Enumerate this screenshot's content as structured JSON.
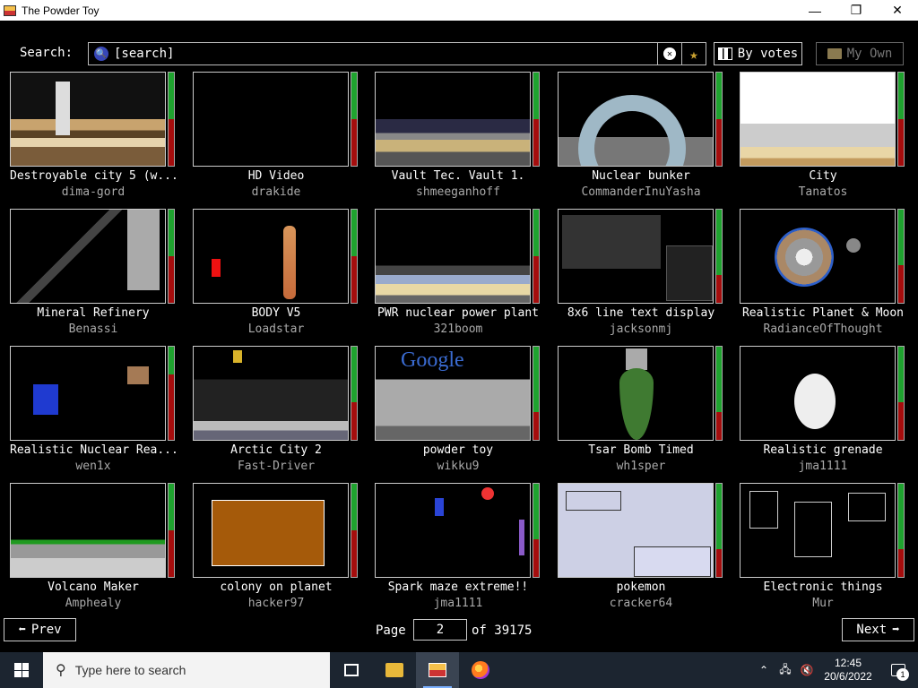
{
  "window": {
    "title": "The Powder Toy",
    "minimize": "—",
    "maximize": "❐",
    "close": "✕"
  },
  "search": {
    "label": "Search:",
    "placeholder": "[search]",
    "clear_glyph": "✕",
    "fav_glyph": "★"
  },
  "toolbar": {
    "sort_label": "By votes",
    "own_label": "My Own"
  },
  "saves": [
    {
      "title": "Destroyable city 5 (w...",
      "author": "dima-gord",
      "upvote_fraction": 0.5,
      "art": "city5"
    },
    {
      "title": "HD Video",
      "author": "drakide",
      "upvote_fraction": 0.5,
      "art": "black"
    },
    {
      "title": "Vault Tec. Vault 1.",
      "author": "shmeeganhoff",
      "upvote_fraction": 0.5,
      "art": "vault"
    },
    {
      "title": "Nuclear bunker",
      "author": "CommanderInuYasha",
      "upvote_fraction": 0.5,
      "art": "bunker"
    },
    {
      "title": "City",
      "author": "Tanatos",
      "upvote_fraction": 0.5,
      "art": "citysky"
    },
    {
      "title": "Mineral Refinery",
      "author": "Benassi",
      "upvote_fraction": 0.5,
      "art": "refinery"
    },
    {
      "title": "BODY V5",
      "author": "Loadstar",
      "upvote_fraction": 0.5,
      "art": "body"
    },
    {
      "title": "PWR nuclear power plant",
      "author": "321boom",
      "upvote_fraction": 0.5,
      "art": "pwr"
    },
    {
      "title": "8x6 line text display",
      "author": "jacksonmj",
      "upvote_fraction": 0.7,
      "art": "text"
    },
    {
      "title": "Realistic Planet & Moon",
      "author": "RadianceOfThought",
      "upvote_fraction": 0.6,
      "art": "planet"
    },
    {
      "title": "Realistic Nuclear Rea...",
      "author": "wen1x",
      "upvote_fraction": 0.3,
      "art": "nuclear"
    },
    {
      "title": "Arctic City 2",
      "author": "Fast-Driver",
      "upvote_fraction": 0.6,
      "art": "arctic"
    },
    {
      "title": "powder toy",
      "author": "wikku9",
      "upvote_fraction": 0.7,
      "art": "google"
    },
    {
      "title": "Tsar Bomb Timed",
      "author": "wh1sper",
      "upvote_fraction": 0.7,
      "art": "tsar"
    },
    {
      "title": "Realistic grenade",
      "author": "jma1111",
      "upvote_fraction": 0.6,
      "art": "grenade"
    },
    {
      "title": "Volcano Maker",
      "author": "Amphealy",
      "upvote_fraction": 0.5,
      "art": "volcano"
    },
    {
      "title": "colony on planet",
      "author": "hacker97",
      "upvote_fraction": 0.5,
      "art": "colony"
    },
    {
      "title": "Spark maze extreme!!",
      "author": "jma1111",
      "upvote_fraction": 0.6,
      "art": "spark"
    },
    {
      "title": "pokemon",
      "author": "cracker64",
      "upvote_fraction": 0.7,
      "art": "pokemon"
    },
    {
      "title": "Electronic things",
      "author": "Mur",
      "upvote_fraction": 0.7,
      "art": "elec"
    }
  ],
  "pagination": {
    "prev_label": "Prev",
    "next_label": "Next",
    "page_label": "Page",
    "current_page": "2",
    "of_label": "of 39175",
    "prev_arrow": "⬅",
    "next_arrow": "➡"
  },
  "taskbar": {
    "search_placeholder": "Type here to search",
    "search_glyph": "⚲",
    "tray_chevron": "⌃",
    "tray_network": "🖧",
    "tray_volume": "🔇",
    "time": "12:45",
    "date": "20/6/2022",
    "notification_count": "1"
  },
  "colors": {
    "vote_up": "#1fa32f",
    "vote_down": "#a50d0d",
    "background": "#000000",
    "taskbar": "#1c2530"
  }
}
